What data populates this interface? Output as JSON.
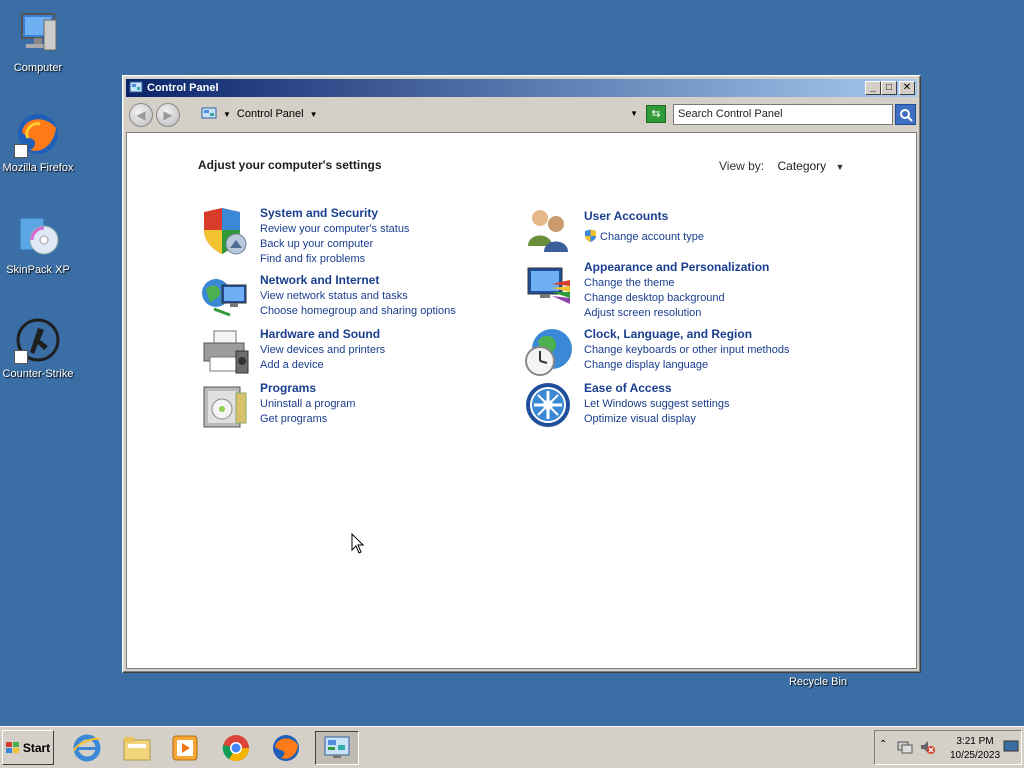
{
  "desktop": {
    "icons": [
      {
        "label": "Computer"
      },
      {
        "label": "Mozilla Firefox"
      },
      {
        "label": "SkinPack XP"
      },
      {
        "label": "Counter-Strike"
      },
      {
        "label": "Recycle Bin"
      }
    ]
  },
  "window": {
    "title": "Control Panel",
    "buttons": {
      "minimize": "_",
      "maximize": "□",
      "close": "✕"
    },
    "address": {
      "path_label": "Control Panel"
    },
    "search": {
      "placeholder": "Search Control Panel"
    }
  },
  "content": {
    "heading": "Adjust your computer's settings",
    "view_by": {
      "label": "View by:",
      "value": "Category"
    },
    "categories": [
      {
        "title": "System and Security",
        "links": [
          "Review your computer's status",
          "Back up your computer",
          "Find and fix problems"
        ]
      },
      {
        "title": "Network and Internet",
        "links": [
          "View network status and tasks",
          "Choose homegroup and sharing options"
        ]
      },
      {
        "title": "Hardware and Sound",
        "links": [
          "View devices and printers",
          "Add a device"
        ]
      },
      {
        "title": "Programs",
        "links": [
          "Uninstall a program",
          "Get programs"
        ]
      },
      {
        "title": "User Accounts",
        "links": [
          "Change account type"
        ]
      },
      {
        "title": "Appearance and Personalization",
        "links": [
          "Change the theme",
          "Change desktop background",
          "Adjust screen resolution"
        ]
      },
      {
        "title": "Clock, Language, and Region",
        "links": [
          "Change keyboards or other input methods",
          "Change display language"
        ]
      },
      {
        "title": "Ease of Access",
        "links": [
          "Let Windows suggest settings",
          "Optimize visual display"
        ]
      }
    ]
  },
  "taskbar": {
    "start_label": "Start",
    "pinned": [
      "internet-explorer-icon",
      "folder-icon",
      "media-player-icon",
      "chrome-icon",
      "firefox-icon",
      "control-panel-icon"
    ],
    "clock": {
      "time": "3:21 PM",
      "date": "10/25/2023"
    }
  }
}
